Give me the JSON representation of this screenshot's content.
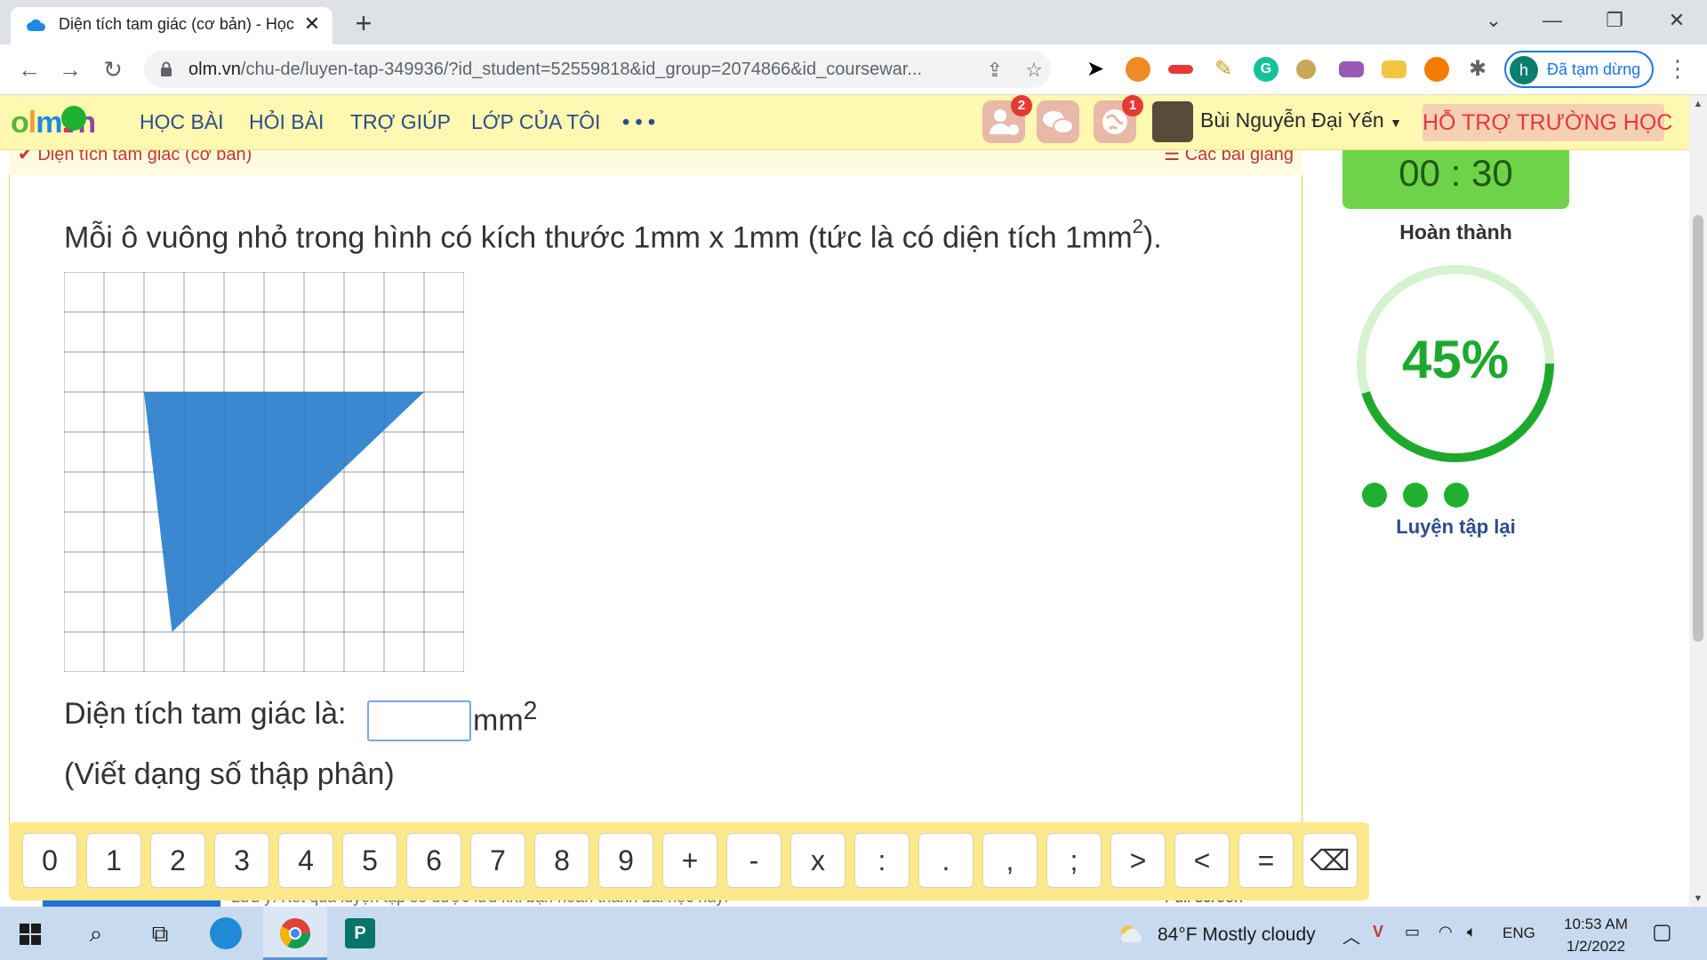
{
  "browser": {
    "tab_title": "Diện tích tam giác (cơ bản) - Học",
    "url_host": "olm.vn",
    "url_path": "/chu-de/luyen-tap-349936/?id_student=52559818&id_group=2074866&id_coursewar...",
    "profile_initial": "h",
    "profile_status": "Đã tạm dừng"
  },
  "site": {
    "logo": {
      "o": "o",
      "l": "l",
      "m": "m",
      "dot": ".",
      "vn": "vn"
    },
    "menu": [
      "HỌC BÀI",
      "HỎI BÀI",
      "TRỢ GIÚP",
      "LỚP CỦA TÔI",
      "• • •"
    ],
    "badges": {
      "friends": "2",
      "globe": "1"
    },
    "user_name": "Bùi Nguyễn Đại Yến",
    "support_button": "HỖ TRỢ TRƯỜNG HỌC",
    "breadcrumb_left": "Diện tích tam giác (cơ bản)",
    "breadcrumb_right": "Các bài giảng"
  },
  "exercise": {
    "question_prefix": "Mỗi ô vuông nhỏ trong hình có kích thước 1mm x 1mm (tức là có diện tích 1mm",
    "question_sup": "2",
    "question_suffix": ").",
    "grid": {
      "cells": 10,
      "triangle_vertices_cells": [
        [
          2,
          3
        ],
        [
          9,
          3
        ],
        [
          2.7,
          9
        ]
      ]
    },
    "answer_label": "Diện tích tam giác là:",
    "answer_value": "",
    "answer_unit": "mm",
    "answer_unit_sup": "2",
    "hint": "(Viết dạng số thập phân)"
  },
  "panel": {
    "timer": "00 : 30",
    "done_label": "Hoàn thành",
    "progress_percent": 45,
    "progress_text": "45%",
    "retry": "Luyện tập lại",
    "colors": {
      "progress": "#1fa82e",
      "track": "#d6f2d0"
    }
  },
  "keypad": [
    "0",
    "1",
    "2",
    "3",
    "4",
    "5",
    "6",
    "7",
    "8",
    "9",
    "+",
    "-",
    "x",
    ":",
    ".",
    ",",
    ";",
    ">",
    "<",
    "=",
    "⌫"
  ],
  "under_strip": {
    "notice": "Lưu ý: Kết quả luyện tập sẽ được lưu khi bạn hoàn thành bài học này!",
    "fullscreen": "Full screen"
  },
  "taskbar": {
    "weather": "84°F  Mostly cloudy",
    "language": "ENG",
    "time": "10:53 AM",
    "date": "1/2/2022"
  }
}
